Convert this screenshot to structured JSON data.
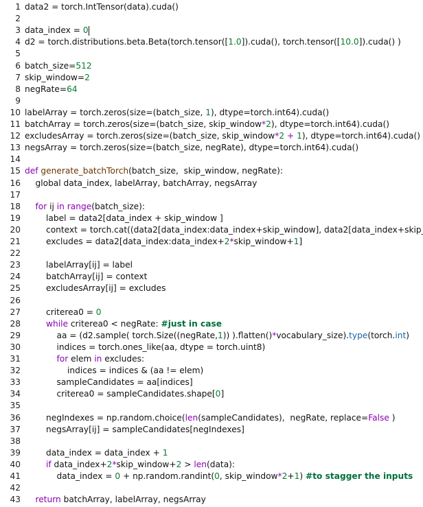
{
  "editor": {
    "cursor_line": 3,
    "lines": [
      {
        "n": "1",
        "t": [
          [
            "",
            "data2 = torch.IntTensor(data).cuda()"
          ]
        ]
      },
      {
        "n": "2",
        "t": []
      },
      {
        "n": "3",
        "t": [
          [
            "",
            "data_index = "
          ],
          [
            "num",
            "0"
          ]
        ]
      },
      {
        "n": "4",
        "t": [
          [
            "",
            "d2 = torch.distributions.beta.Beta(torch.tensor(["
          ],
          [
            "num",
            "1.0"
          ],
          [
            "",
            "]).cuda(), torch.tensor(["
          ],
          [
            "num",
            "10.0"
          ],
          [
            "",
            "]).cuda() )"
          ]
        ]
      },
      {
        "n": "5",
        "t": []
      },
      {
        "n": "6",
        "t": [
          [
            "",
            "batch_size="
          ],
          [
            "num",
            "512"
          ]
        ]
      },
      {
        "n": "7",
        "t": [
          [
            "",
            "skip_window="
          ],
          [
            "num",
            "2"
          ]
        ]
      },
      {
        "n": "8",
        "t": [
          [
            "",
            "negRate="
          ],
          [
            "num",
            "64"
          ]
        ]
      },
      {
        "n": "9",
        "t": []
      },
      {
        "n": "10",
        "t": [
          [
            "",
            "labelArray = torch.zeros(size=(batch_size, "
          ],
          [
            "num",
            "1"
          ],
          [
            "",
            "), dtype=torch.int64).cuda()"
          ]
        ]
      },
      {
        "n": "11",
        "t": [
          [
            "",
            "batchArray = torch.zeros(size=(batch_size, skip_window"
          ],
          [
            "op",
            "*"
          ],
          [
            "num",
            "2"
          ],
          [
            "",
            "), dtype=torch.int64).cuda()"
          ]
        ]
      },
      {
        "n": "12",
        "t": [
          [
            "",
            "excludesArray = torch.zeros(size=(batch_size, skip_window"
          ],
          [
            "op",
            "*"
          ],
          [
            "num",
            "2"
          ],
          [
            "op",
            " + "
          ],
          [
            "num",
            "1"
          ],
          [
            "",
            "), dtype=torch.int64).cuda()"
          ]
        ]
      },
      {
        "n": "13",
        "t": [
          [
            "",
            "negsArray = torch.zeros(size=(batch_size, negRate), dtype=torch.int64).cuda()"
          ]
        ]
      },
      {
        "n": "14",
        "t": []
      },
      {
        "n": "15",
        "t": [
          [
            "kw",
            "def "
          ],
          [
            "fn",
            "generate_batchTorch"
          ],
          [
            "",
            "(batch_size,  skip_window, negRate):"
          ]
        ]
      },
      {
        "n": "16",
        "t": [
          [
            "",
            "    global data_index, labelArray, batchArray, negsArray"
          ]
        ]
      },
      {
        "n": "17",
        "t": []
      },
      {
        "n": "18",
        "t": [
          [
            "",
            "    "
          ],
          [
            "kw",
            "for"
          ],
          [
            "",
            " ij "
          ],
          [
            "kw",
            "in"
          ],
          [
            "",
            " "
          ],
          [
            "bi",
            "range"
          ],
          [
            "",
            "(batch_size):"
          ]
        ]
      },
      {
        "n": "19",
        "t": [
          [
            "",
            "        label = data2[data_index + skip_window ]"
          ]
        ]
      },
      {
        "n": "20",
        "t": [
          [
            "",
            "        context = torch.cat((data2[data_index:data_index+skip_window], data2[data_index+skip_window"
          ],
          [
            "op",
            "+"
          ],
          [
            "num",
            "1"
          ],
          [
            "",
            ":data_index+"
          ],
          [
            "num",
            "2"
          ],
          [
            "op",
            "*"
          ],
          [
            "",
            "skip_window+"
          ],
          [
            "num",
            "1"
          ],
          [
            "",
            "]), "
          ],
          [
            "num",
            "0"
          ],
          [
            "",
            ")"
          ]
        ]
      },
      {
        "n": "21",
        "t": [
          [
            "",
            "        excludes = data2[data_index:data_index+"
          ],
          [
            "num",
            "2"
          ],
          [
            "op",
            "*"
          ],
          [
            "",
            "skip_window+"
          ],
          [
            "num",
            "1"
          ],
          [
            "",
            "]"
          ]
        ]
      },
      {
        "n": "22",
        "t": []
      },
      {
        "n": "23",
        "t": [
          [
            "",
            "        labelArray[ij] = label"
          ]
        ]
      },
      {
        "n": "24",
        "t": [
          [
            "",
            "        batchArray[ij] = context"
          ]
        ]
      },
      {
        "n": "25",
        "t": [
          [
            "",
            "        excludesArray[ij] = excludes"
          ]
        ]
      },
      {
        "n": "26",
        "t": []
      },
      {
        "n": "27",
        "t": [
          [
            "",
            "        criterea0 = "
          ],
          [
            "num",
            "0"
          ]
        ]
      },
      {
        "n": "28",
        "t": [
          [
            "",
            "        "
          ],
          [
            "kw",
            "while"
          ],
          [
            "",
            " criterea0 < negRate: "
          ],
          [
            "cmt",
            "#just in case"
          ]
        ]
      },
      {
        "n": "29",
        "t": [
          [
            "",
            "            aa = (d2.sample( torch.Size((negRate,"
          ],
          [
            "num",
            "1"
          ],
          [
            "",
            ")) ).flatten()"
          ],
          [
            "op",
            "*"
          ],
          [
            "",
            "vocabulary_size)."
          ],
          [
            "attr",
            "type"
          ],
          [
            "",
            "(torch."
          ],
          [
            "attr",
            "int"
          ],
          [
            "",
            ")"
          ]
        ]
      },
      {
        "n": "30",
        "t": [
          [
            "",
            "            indices = torch.ones_like(aa, dtype = torch.uint8)"
          ]
        ]
      },
      {
        "n": "31",
        "t": [
          [
            "",
            "            "
          ],
          [
            "kw",
            "for"
          ],
          [
            "",
            " elem "
          ],
          [
            "kw",
            "in"
          ],
          [
            "",
            " excludes:"
          ]
        ]
      },
      {
        "n": "32",
        "t": [
          [
            "",
            "                indices = indices & (aa != elem)"
          ]
        ]
      },
      {
        "n": "33",
        "t": [
          [
            "",
            "            sampleCandidates = aa[indices]"
          ]
        ]
      },
      {
        "n": "34",
        "t": [
          [
            "",
            "            criterea0 = sampleCandidates.shape["
          ],
          [
            "num",
            "0"
          ],
          [
            "",
            "]"
          ]
        ]
      },
      {
        "n": "35",
        "t": []
      },
      {
        "n": "36",
        "t": [
          [
            "",
            "        negIndexes = np.random.choice("
          ],
          [
            "bi",
            "len"
          ],
          [
            "",
            "(sampleCandidates),  negRate, replace="
          ],
          [
            "cls",
            "False"
          ],
          [
            "",
            " )"
          ]
        ]
      },
      {
        "n": "37",
        "t": [
          [
            "",
            "        negsArray[ij] = sampleCandidates[negIndexes]"
          ]
        ]
      },
      {
        "n": "38",
        "t": []
      },
      {
        "n": "39",
        "t": [
          [
            "",
            "        data_index = data_index + "
          ],
          [
            "num",
            "1"
          ]
        ]
      },
      {
        "n": "40",
        "t": [
          [
            "",
            "        "
          ],
          [
            "kw",
            "if"
          ],
          [
            "",
            " data_index+"
          ],
          [
            "num",
            "2"
          ],
          [
            "op",
            "*"
          ],
          [
            "",
            "skip_window+"
          ],
          [
            "num",
            "2"
          ],
          [
            "",
            " > "
          ],
          [
            "bi",
            "len"
          ],
          [
            "",
            "(data):"
          ]
        ]
      },
      {
        "n": "41",
        "t": [
          [
            "",
            "            data_index = "
          ],
          [
            "num",
            "0"
          ],
          [
            "",
            " + np.random.randint("
          ],
          [
            "num",
            "0"
          ],
          [
            "",
            ", skip_window"
          ],
          [
            "op",
            "*"
          ],
          [
            "num",
            "2"
          ],
          [
            "",
            "+"
          ],
          [
            "num",
            "1"
          ],
          [
            "",
            ") "
          ],
          [
            "cmt",
            "#to stagger the inputs"
          ]
        ]
      },
      {
        "n": "42",
        "t": []
      },
      {
        "n": "43",
        "t": [
          [
            "",
            "    "
          ],
          [
            "kw",
            "return"
          ],
          [
            "",
            " batchArray, labelArray, negsArray"
          ]
        ]
      }
    ]
  }
}
